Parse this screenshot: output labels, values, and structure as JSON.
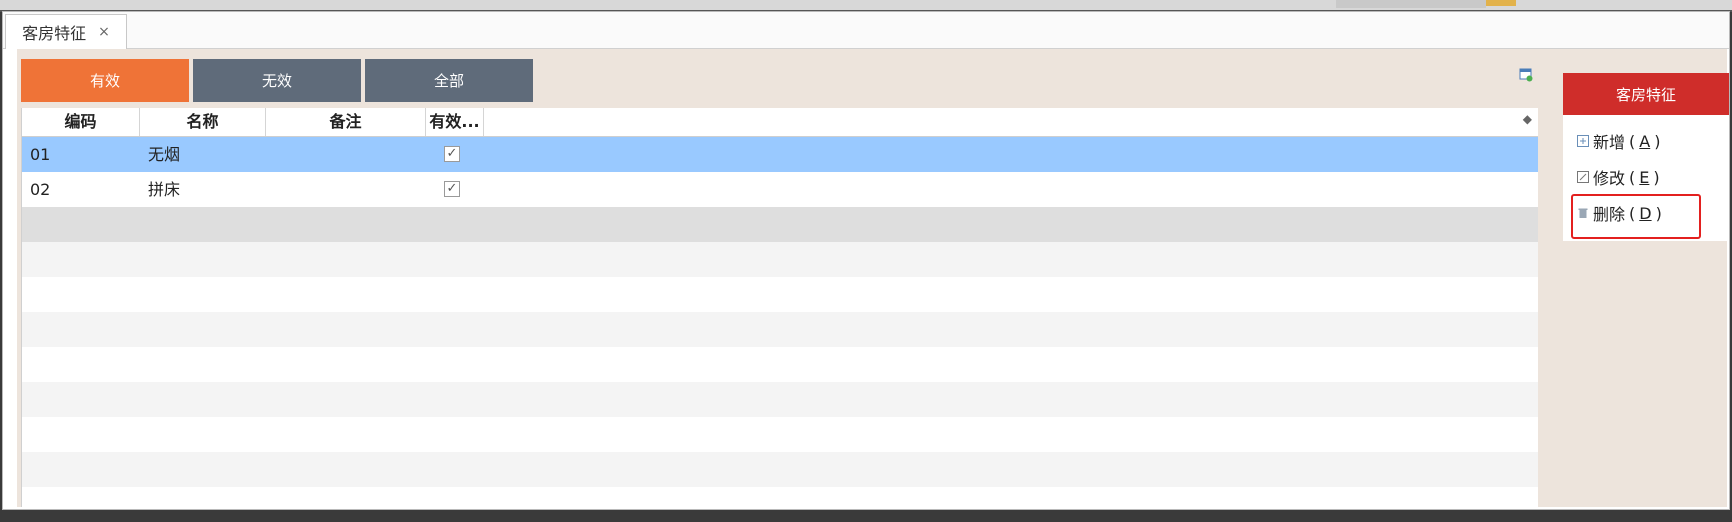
{
  "tab": {
    "label": "客房特征",
    "close": "×"
  },
  "filters": [
    {
      "label": "有效",
      "active": true
    },
    {
      "label": "无效",
      "active": false
    },
    {
      "label": "全部",
      "active": false
    }
  ],
  "grid": {
    "columns": [
      "编码",
      "名称",
      "备注",
      "有效..."
    ],
    "rows": [
      {
        "code": "01",
        "name": "无烟",
        "note": "",
        "valid": true,
        "selected": true
      },
      {
        "code": "02",
        "name": "拼床",
        "note": "",
        "valid": true,
        "selected": false
      }
    ]
  },
  "sidepanel": {
    "title": "客房特征",
    "actions": [
      {
        "label": "新增",
        "key": "A",
        "icon": "plus-box-icon"
      },
      {
        "label": "修改",
        "key": "E",
        "icon": "edit-icon"
      },
      {
        "label": "删除",
        "key": "D",
        "icon": "trash-icon"
      }
    ]
  },
  "colors": {
    "accent": "#ef7337",
    "panelHeader": "#cf2d2a",
    "selectedRow": "#99c9ff",
    "filterInactive": "#5f6b7a"
  }
}
